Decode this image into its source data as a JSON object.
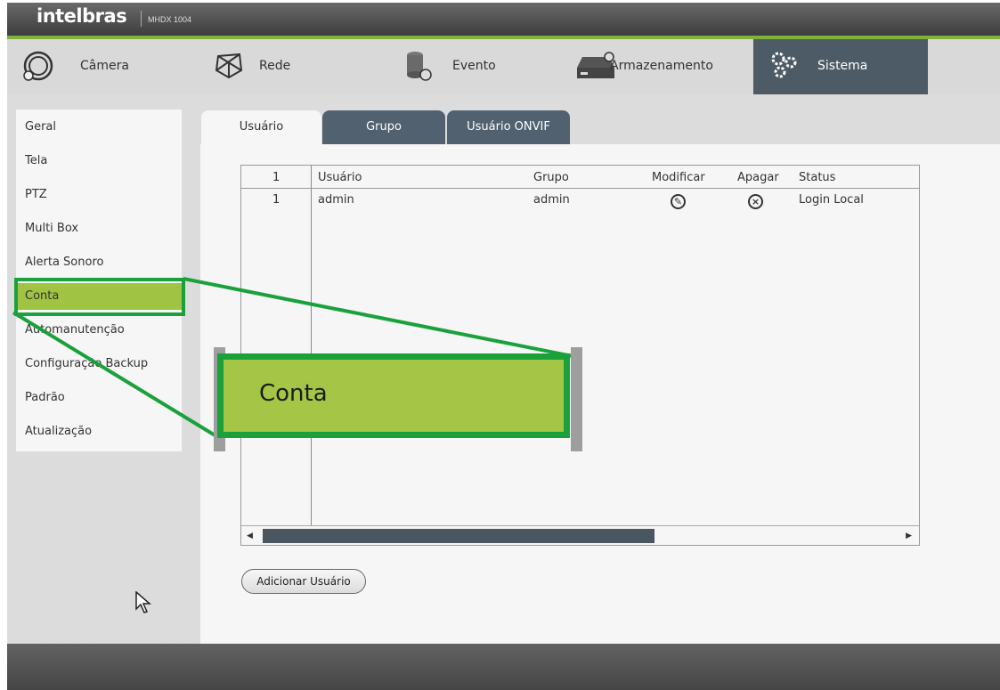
{
  "brand": {
    "logo": "intelbras",
    "model": "MHDX 1004"
  },
  "topnav": [
    {
      "label": "Câmera",
      "icon": "camera-icon"
    },
    {
      "label": "Rede",
      "icon": "network-icon"
    },
    {
      "label": "Evento",
      "icon": "event-icon"
    },
    {
      "label": "Armazenamento",
      "icon": "storage-icon"
    },
    {
      "label": "Sistema",
      "icon": "gear-icon",
      "active": true
    }
  ],
  "sidebar": {
    "items": [
      {
        "label": "Geral"
      },
      {
        "label": "Tela"
      },
      {
        "label": "PTZ"
      },
      {
        "label": "Multi Box"
      },
      {
        "label": "Alerta Sonoro"
      },
      {
        "label": "Conta",
        "active": true
      },
      {
        "label": "Automanutenção"
      },
      {
        "label": "Configuração Backup"
      },
      {
        "label": "Padrão"
      },
      {
        "label": "Atualização"
      }
    ]
  },
  "tabs": [
    {
      "label": "Usuário",
      "active": true
    },
    {
      "label": "Grupo"
    },
    {
      "label": "Usuário ONVIF"
    }
  ],
  "table": {
    "headers": {
      "num": "1",
      "user": "Usuário",
      "group": "Grupo",
      "modify": "Modificar",
      "delete": "Apagar",
      "status": "Status"
    },
    "rows": [
      {
        "num": "1",
        "user": "admin",
        "group": "admin",
        "modify_icon": "edit-icon",
        "delete_icon": "delete-icon",
        "status": "Login Local"
      }
    ]
  },
  "actions": {
    "add_user": "Adicionar Usuário"
  },
  "callout": {
    "label": "Conta"
  },
  "colors": {
    "accent_green": "#1aa13c",
    "highlight": "#a4c545",
    "tab_dark": "#516170",
    "nav_active": "#4d5b66"
  }
}
